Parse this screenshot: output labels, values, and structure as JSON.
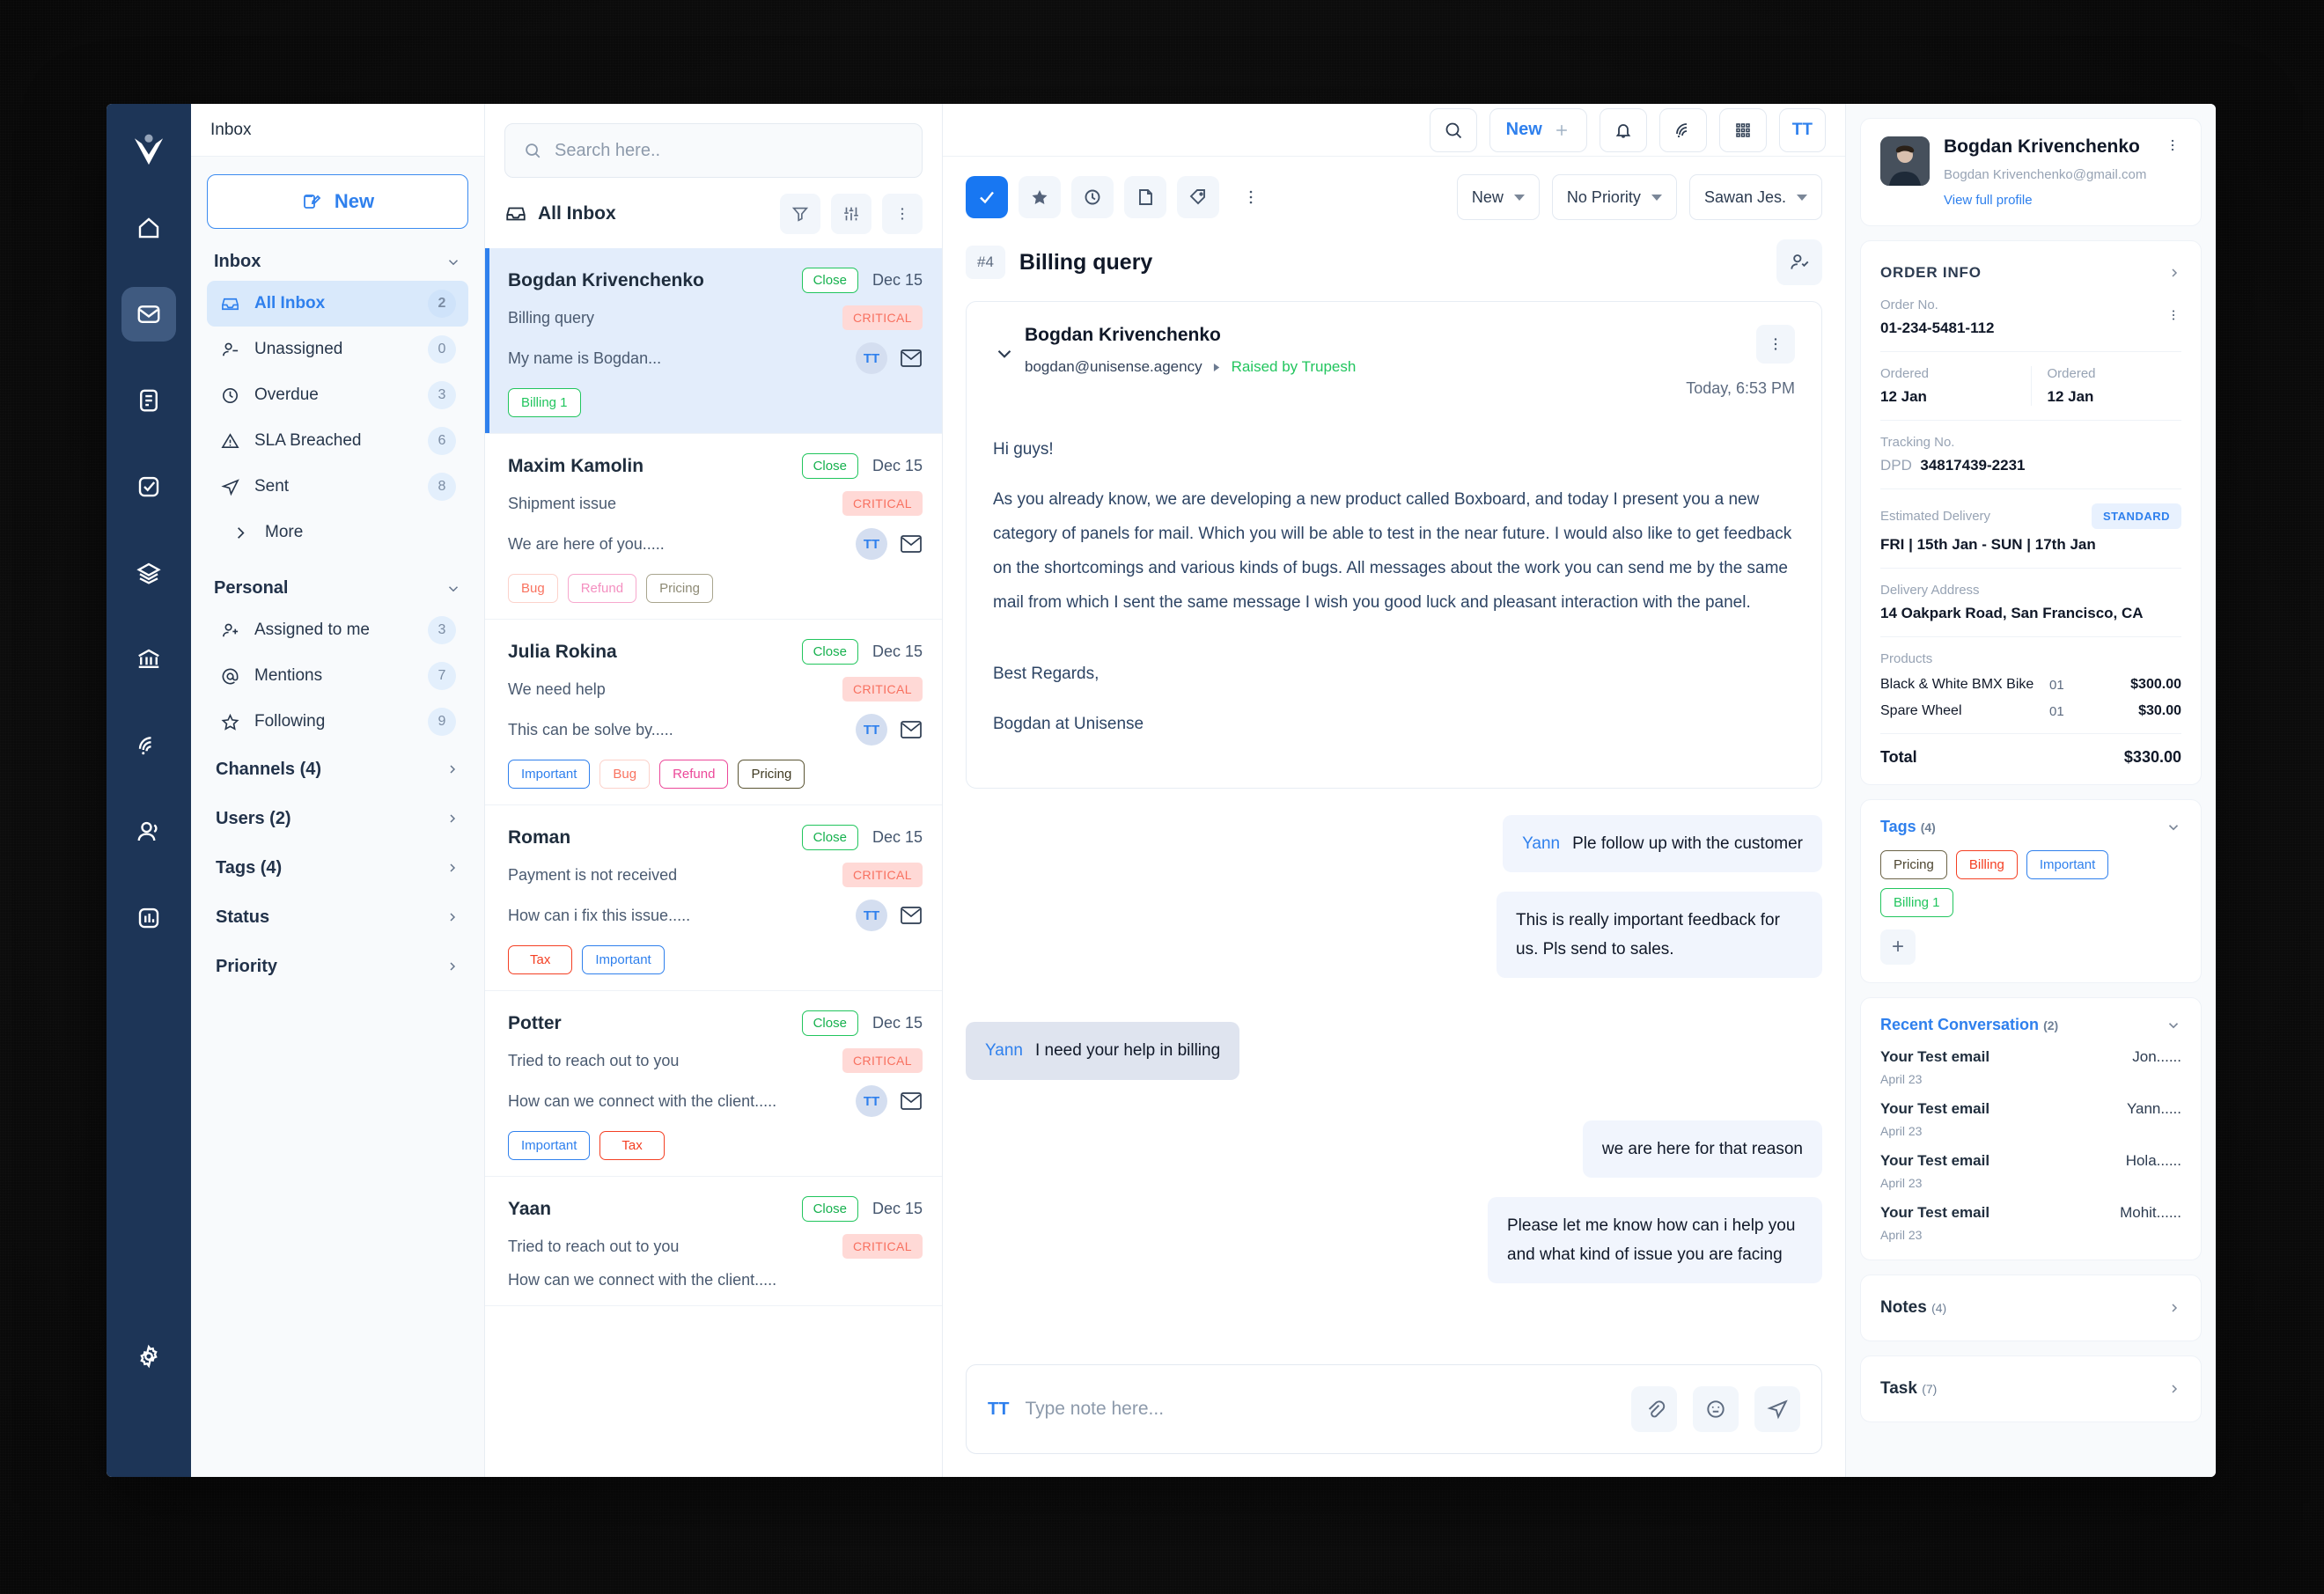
{
  "app": {
    "page_title": "Inbox",
    "logo_icon": "brand-v-logo"
  },
  "rail": {
    "items": [
      {
        "name": "home-icon",
        "label": "Home"
      },
      {
        "name": "mail-icon",
        "label": "Inbox",
        "active": true
      },
      {
        "name": "document-icon",
        "label": "Documents"
      },
      {
        "name": "tasks-icon",
        "label": "Tasks"
      },
      {
        "name": "layers-icon",
        "label": "Layers"
      },
      {
        "name": "bank-icon",
        "label": "Bank"
      },
      {
        "name": "broadcast-icon",
        "label": "Broadcast"
      },
      {
        "name": "contacts-icon",
        "label": "Contacts"
      },
      {
        "name": "reports-icon",
        "label": "Reports"
      }
    ],
    "settings_label": "Settings"
  },
  "topbar": {
    "search_icon": "search-icon",
    "new_label": "New",
    "plus_icon": "plus-icon",
    "bell_icon": "bell-icon",
    "broadcast_icon": "broadcast-icon",
    "grid_icon": "grid-apps-icon",
    "avatar_initials": "TT"
  },
  "sidebar": {
    "new_button": "New",
    "inbox_section": "Inbox",
    "inbox_items": [
      {
        "label": "All Inbox",
        "badge": "2",
        "icon": "inbox-icon",
        "active": true
      },
      {
        "label": "Unassigned",
        "badge": "0",
        "icon": "user-minus-icon"
      },
      {
        "label": "Overdue",
        "badge": "3",
        "icon": "clock-icon"
      },
      {
        "label": "SLA Breached",
        "badge": "6",
        "icon": "alert-triangle-icon"
      },
      {
        "label": "Sent",
        "badge": "8",
        "icon": "send-icon"
      },
      {
        "label": "More",
        "badge": "",
        "icon": "chevron-right-icon"
      }
    ],
    "personal_section": "Personal",
    "personal_items": [
      {
        "label": "Assigned to me",
        "badge": "3",
        "icon": "user-plus-icon"
      },
      {
        "label": "Mentions",
        "badge": "7",
        "icon": "at-icon"
      },
      {
        "label": "Following",
        "badge": "9",
        "icon": "star-outline-icon"
      }
    ],
    "groups": [
      {
        "label": "Channels (4)"
      },
      {
        "label": "Users (2)"
      },
      {
        "label": "Tags (4)"
      },
      {
        "label": "Status"
      },
      {
        "label": "Priority"
      }
    ]
  },
  "list": {
    "search_placeholder": "Search here..",
    "search_value": "",
    "header_label": "All Inbox",
    "header_icon": "inbox-icon",
    "filter_icon": "filter-icon",
    "sort_icon": "sort-sliders-icon",
    "more_icon": "more-vertical-icon",
    "conversations": [
      {
        "name": "Bogdan Krivenchenko",
        "status": "Close",
        "date": "Dec 15",
        "subject": "Billing query",
        "priority": "CRITICAL",
        "preview": "My name is Bogdan...",
        "avatar": "TT",
        "tags": [
          {
            "label": "Billing 1",
            "color": "#22c55e"
          }
        ],
        "selected": true
      },
      {
        "name": "Maxim Kamolin",
        "status": "Close",
        "date": "Dec 15",
        "subject": "Shipment issue",
        "priority": "CRITICAL",
        "preview": "We are here of you.....",
        "avatar": "TT",
        "tags": [
          {
            "label": "Bug",
            "color": "#f97360"
          },
          {
            "label": "Refund",
            "color": "#ec4899"
          },
          {
            "label": "Pricing",
            "color": "#7c7348"
          }
        ]
      },
      {
        "name": "Julia Rokina",
        "status": "Close",
        "date": "Dec 15",
        "subject": "We need help",
        "priority": "CRITICAL",
        "preview": "This can be solve by.....",
        "avatar": "TT",
        "tags": [
          {
            "label": "Important",
            "color": "#2f80ed"
          },
          {
            "label": "Bug",
            "color": "#f97360"
          },
          {
            "label": "Refund",
            "color": "#ec4899"
          },
          {
            "label": "Pricing",
            "color": "#3f3a22"
          }
        ]
      },
      {
        "name": "Roman",
        "status": "Close",
        "date": "Dec 15",
        "subject": "Payment is not received",
        "priority": "CRITICAL",
        "preview": "How can i fix this issue.....",
        "avatar": "TT",
        "tags": [
          {
            "label": "Tax",
            "color": "#f43f23"
          },
          {
            "label": "Important",
            "color": "#2f80ed"
          }
        ]
      },
      {
        "name": "Potter",
        "status": "Close",
        "date": "Dec 15",
        "subject": "Tried to reach out to you",
        "priority": "CRITICAL",
        "preview": "How can we connect with the client.....",
        "avatar": "TT",
        "tags": [
          {
            "label": "Important",
            "color": "#2f80ed"
          },
          {
            "label": "Tax",
            "color": "#f43f23"
          }
        ]
      },
      {
        "name": "Yaan",
        "status": "Close",
        "date": "Dec 15",
        "subject": "Tried to reach out to you",
        "priority": "CRITICAL",
        "preview": "How can we connect with the client.....",
        "avatar": "TT",
        "tags": []
      }
    ]
  },
  "thread": {
    "toolbar_icons": [
      "check-icon",
      "star-icon",
      "clock-icon",
      "archive-icon",
      "tag-icon",
      "more-vertical-icon"
    ],
    "status_select": "New",
    "priority_select": "No Priority",
    "assignee_select": "Sawan Jes.",
    "ticket_number": "#4",
    "subject": "Billing query",
    "assign_icon": "assign-user-icon",
    "message": {
      "from_name": "Bogdan Krivenchenko",
      "from_email": "bogdan@unisense.agency",
      "raised_by": "Raised by Trupesh",
      "time": "Today, 6:53 PM",
      "greeting": "Hi guys!",
      "paragraph": "As you already know, we are developing a new product called Boxboard, and today I present you a new category of panels for mail. Which you will be able to test in the near future. I would also like to get feedback on the shortcomings and various kinds of bugs. All messages about the work you can send me by the same mail from which I sent the same message I wish you good luck and pleasant interaction with the panel.",
      "signoff": "Best Regards,",
      "signature": "Bogdan at Unisense"
    },
    "bubbles": [
      {
        "side": "right",
        "style": "blue",
        "who": "Yann",
        "text": "Ple follow up with the customer"
      },
      {
        "side": "right",
        "style": "blue",
        "who": "",
        "text": "This is really important feedback for us. Pls send to sales."
      },
      {
        "side": "left",
        "style": "grey",
        "who": "Yann",
        "text": "I need your help in billing"
      },
      {
        "side": "right",
        "style": "blue",
        "who": "",
        "text": "we are here for that reason"
      },
      {
        "side": "right",
        "style": "blue",
        "who": "",
        "text": "Please let me know how can i help you and what kind of issue you are facing"
      }
    ],
    "composer": {
      "mark": "TT",
      "placeholder": "Type note here...",
      "value": "",
      "attach_icon": "paperclip-icon",
      "emoji_icon": "emoji-icon",
      "send_icon": "send-icon"
    }
  },
  "details": {
    "profile": {
      "name": "Bogdan Krivenchenko",
      "email": "Bogdan Krivenchenko@gmail.com",
      "view_profile": "View full profile",
      "avatar_icon": "user-photo"
    },
    "order_info": {
      "title": "ORDER INFO",
      "order_no_label": "Order No.",
      "order_no": "01-234-5481-112",
      "ordered_label_1": "Ordered",
      "ordered_value_1": "12 Jan",
      "ordered_label_2": "Ordered",
      "ordered_value_2": "12 Jan",
      "tracking_label": "Tracking No.",
      "tracking_carrier": "DPD",
      "tracking_no": "34817439-2231",
      "delivery_label": "Estimated Delivery",
      "delivery_badge": "STANDARD",
      "delivery_value": "FRI  |  15th Jan - SUN  |  17th Jan",
      "address_label": "Delivery Address",
      "address_value": "14 Oakpark Road, San Francisco, CA",
      "products_label": "Products",
      "products": [
        {
          "name": "Black & White BMX Bike",
          "qty": "01",
          "price": "$300.00"
        },
        {
          "name": "Spare Wheel",
          "qty": "01",
          "price": "$30.00"
        }
      ],
      "total_label": "Total",
      "total_value": "$330.00"
    },
    "tags": {
      "title": "Tags",
      "count": "(4)",
      "items": [
        {
          "label": "Pricing",
          "color": "#4d4630"
        },
        {
          "label": "Billing",
          "color": "#f43f23"
        },
        {
          "label": "Important",
          "color": "#2f80ed"
        },
        {
          "label": "Billing 1",
          "color": "#22c55e"
        }
      ],
      "add_icon": "plus-icon"
    },
    "recent": {
      "title": "Recent Conversation",
      "count": "(2)",
      "items": [
        {
          "subject": "Your Test email",
          "date": "April 23",
          "who": "Jon......"
        },
        {
          "subject": "Your Test email",
          "date": "April 23",
          "who": "Yann....."
        },
        {
          "subject": "Your Test email",
          "date": "April 23",
          "who": "Hola......"
        },
        {
          "subject": "Your Test email",
          "date": "April 23",
          "who": "Mohit......"
        }
      ]
    },
    "notes": {
      "title": "Notes",
      "count": "(4)"
    },
    "task": {
      "title": "Task",
      "count": "(7)"
    }
  },
  "colors": {
    "accent": "#2f80ed",
    "rail_bg": "#1d3557",
    "critical_bg": "#ffd9d6",
    "critical_fg": "#f8705f",
    "close_green": "#21c55d"
  }
}
